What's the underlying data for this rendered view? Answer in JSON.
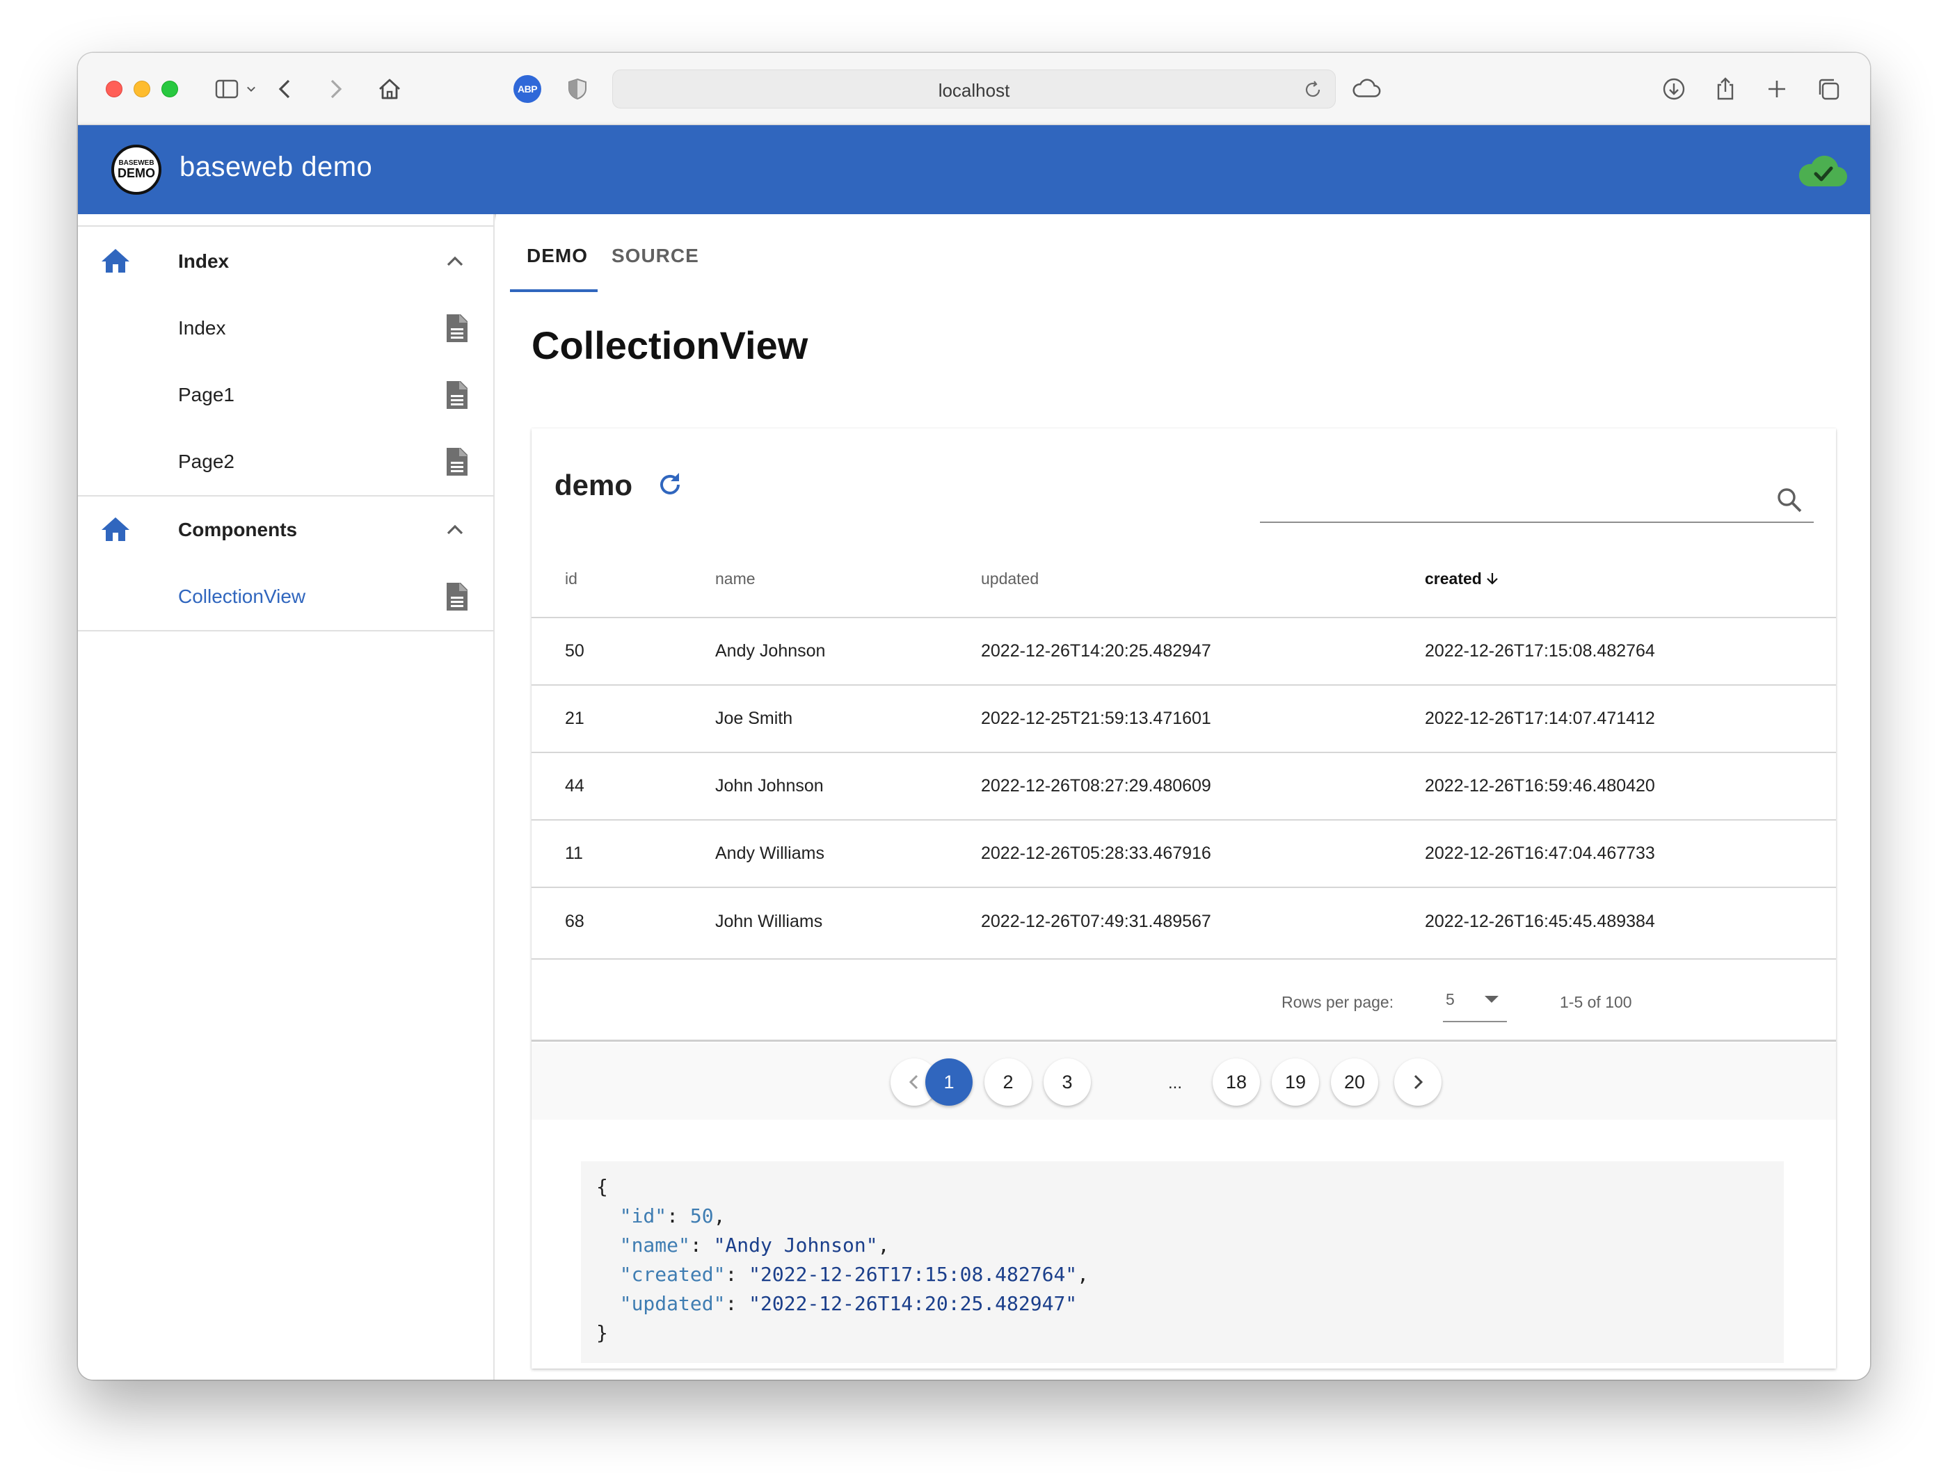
{
  "browser": {
    "url": "localhost",
    "adblock_label": "ABP"
  },
  "app": {
    "logo_top": "BASEWEB",
    "logo_bottom": "DEMO",
    "title": "baseweb demo",
    "status_icon": "cloud-check-icon",
    "brand_color": "#3066be",
    "status_color": "#4caf50"
  },
  "sidebar": {
    "groups": [
      {
        "label": "Index",
        "icon": "home-icon",
        "items": [
          {
            "label": "Index",
            "icon": "document-icon"
          },
          {
            "label": "Page1",
            "icon": "document-icon"
          },
          {
            "label": "Page2",
            "icon": "document-icon"
          }
        ]
      },
      {
        "label": "Components",
        "icon": "home-icon",
        "items": [
          {
            "label": "CollectionView",
            "icon": "document-icon",
            "active": true
          }
        ]
      }
    ]
  },
  "tabs": [
    {
      "label": "DEMO",
      "active": true
    },
    {
      "label": "SOURCE",
      "active": false
    }
  ],
  "page_title": "CollectionView",
  "collection": {
    "title": "demo",
    "search_value": "",
    "columns": [
      "id",
      "name",
      "updated",
      "created"
    ],
    "sorted_column": "created",
    "sort_direction": "descending",
    "rows": [
      {
        "id": "50",
        "name": "Andy Johnson",
        "updated": "2022-12-26T14:20:25.482947",
        "created": "2022-12-26T17:15:08.482764"
      },
      {
        "id": "21",
        "name": "Joe Smith",
        "updated": "2022-12-25T21:59:13.471601",
        "created": "2022-12-26T17:14:07.471412"
      },
      {
        "id": "44",
        "name": "John Johnson",
        "updated": "2022-12-26T08:27:29.480609",
        "created": "2022-12-26T16:59:46.480420"
      },
      {
        "id": "11",
        "name": "Andy Williams",
        "updated": "2022-12-26T05:28:33.467916",
        "created": "2022-12-26T16:47:04.467733"
      },
      {
        "id": "68",
        "name": "John Williams",
        "updated": "2022-12-26T07:49:31.489567",
        "created": "2022-12-26T16:45:45.489384"
      }
    ],
    "rows_per_page_label": "Rows per page:",
    "rows_per_page": "5",
    "range_text": "1-5 of 100"
  },
  "pagination": {
    "pages": [
      "1",
      "2",
      "3",
      "18",
      "19",
      "20"
    ],
    "current": "1",
    "ellipsis": "..."
  },
  "selected_json": {
    "open": "{",
    "close": "}",
    "lines": [
      {
        "key": "\"id\"",
        "value": "50",
        "type": "number",
        "sep": ","
      },
      {
        "key": "\"name\"",
        "value": "\"Andy Johnson\"",
        "type": "string",
        "sep": ","
      },
      {
        "key": "\"created\"",
        "value": "\"2022-12-26T17:15:08.482764\"",
        "type": "string",
        "sep": ","
      },
      {
        "key": "\"updated\"",
        "value": "\"2022-12-26T14:20:25.482947\"",
        "type": "string",
        "sep": ""
      }
    ]
  }
}
